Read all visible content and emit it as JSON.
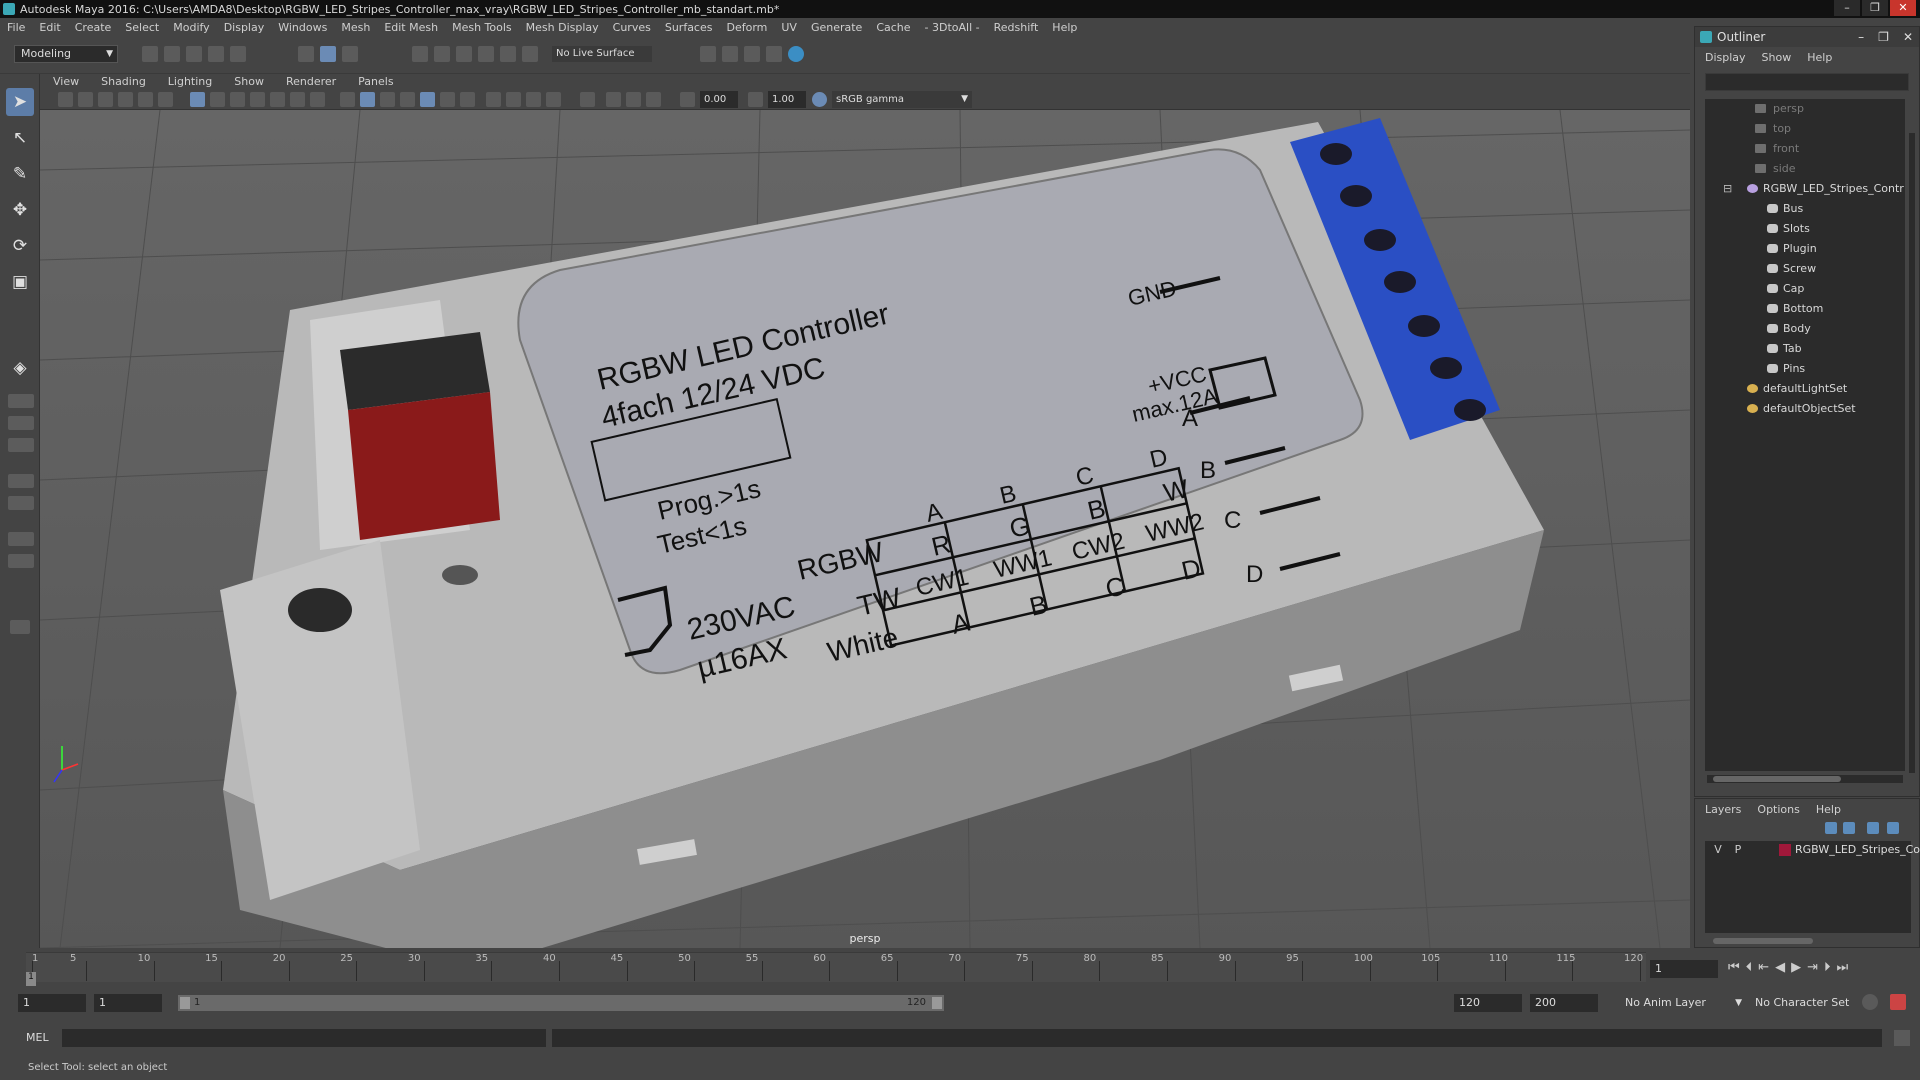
{
  "window": {
    "title": "Autodesk Maya 2016: C:\\Users\\AMDA8\\Desktop\\RGBW_LED_Stripes_Controller_max_vray\\RGBW_LED_Stripes_Controller_mb_standart.mb*",
    "buttons": [
      "–",
      "❐",
      "✕"
    ]
  },
  "menubar": [
    "File",
    "Edit",
    "Create",
    "Select",
    "Modify",
    "Display",
    "Windows",
    "Mesh",
    "Edit Mesh",
    "Mesh Tools",
    "Mesh Display",
    "Curves",
    "Surfaces",
    "Deform",
    "UV",
    "Generate",
    "Cache",
    "- 3DtoAll -",
    "Redshift",
    "Help"
  ],
  "shelf": {
    "mode": "Modeling",
    "live_surface": "No Live Surface"
  },
  "panel": {
    "menu": [
      "View",
      "Shading",
      "Lighting",
      "Show",
      "Renderer",
      "Panels"
    ],
    "exposure": "0.00",
    "gamma": "1.00",
    "color_space": "sRGB gamma"
  },
  "viewport": {
    "camera": "persp",
    "label": {
      "gnd": "GND",
      "vcc": "+VCC",
      "max": "max.12A",
      "title1": "RGBW LED Controller",
      "title2": "4fach 12/24 VDC",
      "prog": "Prog.>1s",
      "test": "Test<1s",
      "ac": "230VAC",
      "ax": "µ16AX",
      "row_rgbw": "RGBW",
      "row_tw": "TW",
      "row_white": "White",
      "col_a": "A",
      "col_b": "B",
      "col_c": "C",
      "col_d": "D",
      "rgbw_vals": [
        "R",
        "G",
        "B",
        "W"
      ],
      "tw_vals": [
        "CW1",
        "WW1",
        "CW2",
        "WW2"
      ],
      "white_vals": [
        "A",
        "B",
        "C",
        "D"
      ],
      "pin_a": "A",
      "pin_b": "B",
      "pin_c": "C",
      "pin_d": "D"
    }
  },
  "outliner": {
    "title": "Outliner",
    "menu": [
      "Display",
      "Show",
      "Help"
    ],
    "items": [
      {
        "label": "persp",
        "kind": "camera"
      },
      {
        "label": "top",
        "kind": "camera"
      },
      {
        "label": "front",
        "kind": "camera"
      },
      {
        "label": "side",
        "kind": "camera"
      },
      {
        "label": "RGBW_LED_Stripes_Contr",
        "kind": "group"
      },
      {
        "label": "Bus",
        "kind": "mesh"
      },
      {
        "label": "Slots",
        "kind": "mesh"
      },
      {
        "label": "Plugin",
        "kind": "mesh"
      },
      {
        "label": "Screw",
        "kind": "mesh"
      },
      {
        "label": "Cap",
        "kind": "mesh"
      },
      {
        "label": "Bottom",
        "kind": "mesh"
      },
      {
        "label": "Body",
        "kind": "mesh"
      },
      {
        "label": "Tab",
        "kind": "mesh"
      },
      {
        "label": "Pins",
        "kind": "mesh"
      },
      {
        "label": "defaultLightSet",
        "kind": "set"
      },
      {
        "label": "defaultObjectSet",
        "kind": "set"
      }
    ]
  },
  "layers": {
    "menu": [
      "Layers",
      "Options",
      "Help"
    ],
    "rows": [
      {
        "v": "V",
        "p": "P",
        "name": "RGBW_LED_Stripes_Co",
        "color": "#a0183a"
      }
    ]
  },
  "timeline": {
    "ticks": [
      "1",
      "5",
      "10",
      "15",
      "20",
      "25",
      "30",
      "35",
      "40",
      "45",
      "50",
      "55",
      "60",
      "65",
      "70",
      "75",
      "80",
      "85",
      "90",
      "95",
      "100",
      "105",
      "110",
      "115",
      "120"
    ],
    "current_frame": "1"
  },
  "range": {
    "start": "1",
    "playback_start": "1",
    "slider_start": "1",
    "slider_end": "120",
    "playback_end": "120",
    "end": "200",
    "anim_layer": "No Anim Layer",
    "char_set": "No Character Set"
  },
  "command": {
    "lang": "MEL"
  },
  "help_line": "Select Tool: select an object"
}
